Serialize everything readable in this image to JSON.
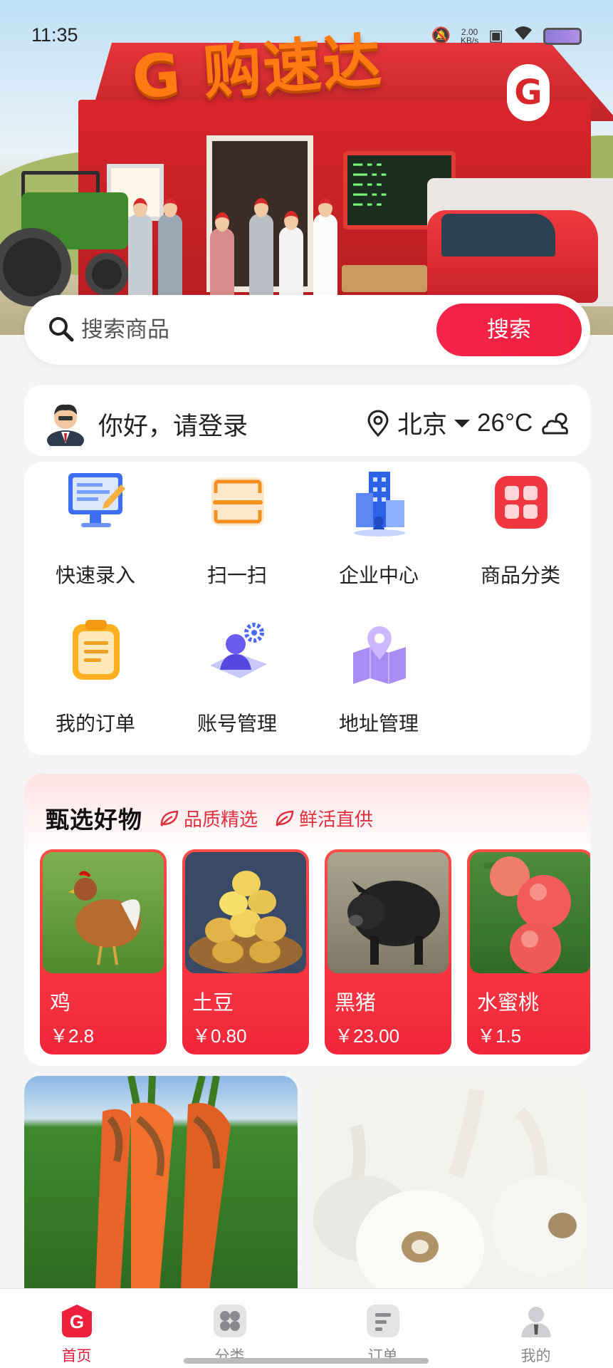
{
  "status_bar": {
    "time": "11:35",
    "speed_value": "2.00",
    "speed_unit": "KB/s"
  },
  "hero": {
    "brand_text": "G 购速达",
    "side_logo": "G"
  },
  "search": {
    "placeholder": "搜索商品",
    "button_label": "搜索"
  },
  "user": {
    "greeting": "你好，请登录",
    "city": "北京",
    "temperature": "26°C",
    "weather_icon": "partly-cloudy-icon"
  },
  "quick_actions": [
    {
      "label": "快速录入",
      "icon": "computer-edit-icon"
    },
    {
      "label": "扫一扫",
      "icon": "scan-icon"
    },
    {
      "label": "企业中心",
      "icon": "building-icon"
    },
    {
      "label": "商品分类",
      "icon": "category-grid-icon"
    },
    {
      "label": "我的订单",
      "icon": "clipboard-icon"
    },
    {
      "label": "账号管理",
      "icon": "account-settings-icon"
    },
    {
      "label": "地址管理",
      "icon": "map-pin-icon"
    }
  ],
  "selected": {
    "title": "甄选好物",
    "tags": [
      "品质精选",
      "鲜活直供"
    ],
    "goods": [
      {
        "name": "鸡",
        "price": "￥2.8"
      },
      {
        "name": "土豆",
        "price": "￥0.80"
      },
      {
        "name": "黑猪",
        "price": "￥23.00"
      },
      {
        "name": "水蜜桃",
        "price": "￥1.5"
      }
    ]
  },
  "tabbar": {
    "tabs": [
      {
        "label": "首页",
        "active": true
      },
      {
        "label": "分类",
        "active": false
      },
      {
        "label": "订单",
        "active": false
      },
      {
        "label": "我的",
        "active": false
      }
    ]
  },
  "colors": {
    "accent": "#ee1f3d",
    "background": "#f4f4f6"
  }
}
